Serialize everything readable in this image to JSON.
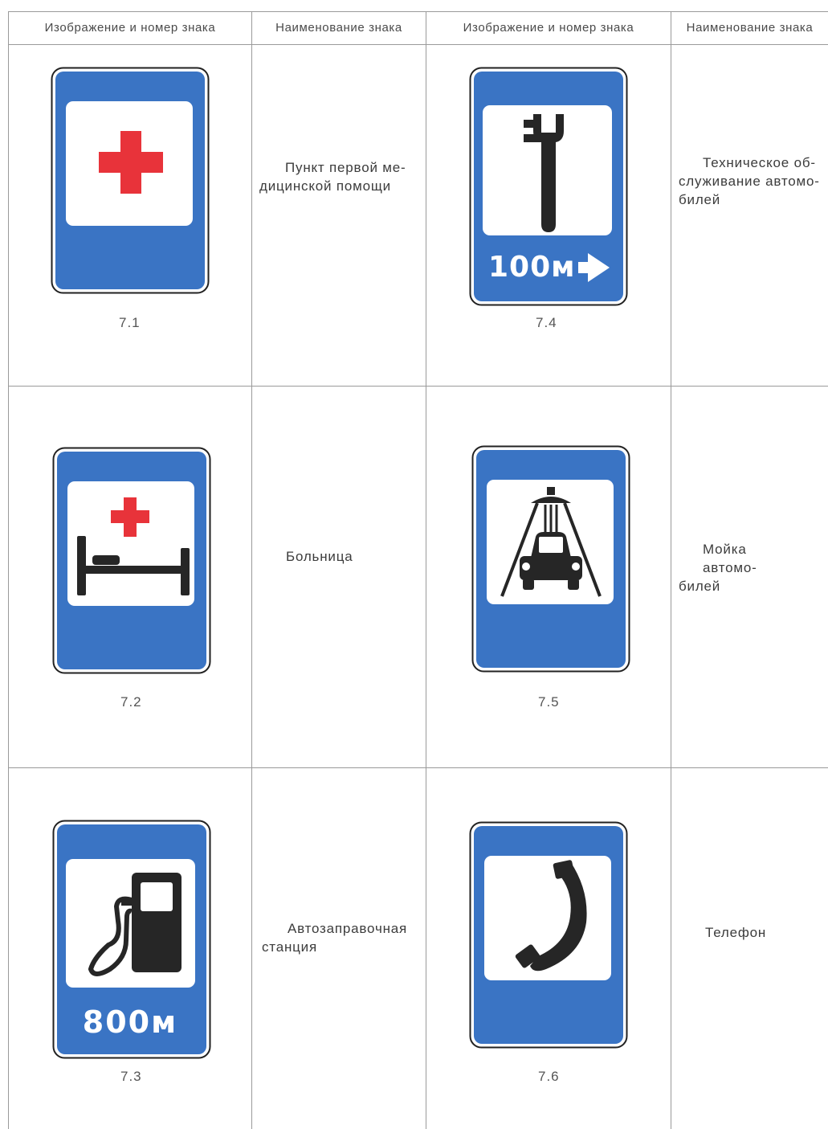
{
  "headers": {
    "col1": "Изображение и номер знака",
    "col2": "Наименование знака",
    "col3": "Изображение и номер знака",
    "col4": "Наименование знака"
  },
  "signs": [
    {
      "number": "7.1",
      "name_lines": [
        "Пункт первой ме-",
        "дицинской помощи"
      ],
      "icon": "first-aid-cross-icon"
    },
    {
      "number": "7.2",
      "name_lines": [
        "Больница"
      ],
      "icon": "hospital-bed-icon"
    },
    {
      "number": "7.3",
      "name_lines": [
        "Автозаправочная",
        "станция"
      ],
      "icon": "fuel-pump-icon",
      "plate": "800м"
    },
    {
      "number": "7.4",
      "name_lines": [
        "Техническое об-",
        "служивание автомо-",
        "билей"
      ],
      "icon": "wrench-icon",
      "plate": "100м"
    },
    {
      "number": "7.5",
      "name_lines": [
        "Мойка автомо-",
        "билей"
      ],
      "icon": "car-wash-icon"
    },
    {
      "number": "7.6",
      "name_lines": [
        "Телефон"
      ],
      "icon": "telephone-icon"
    }
  ],
  "colors": {
    "sign_blue": "#3a74c4",
    "sign_black": "#262626",
    "cross_red": "#e8333a"
  }
}
